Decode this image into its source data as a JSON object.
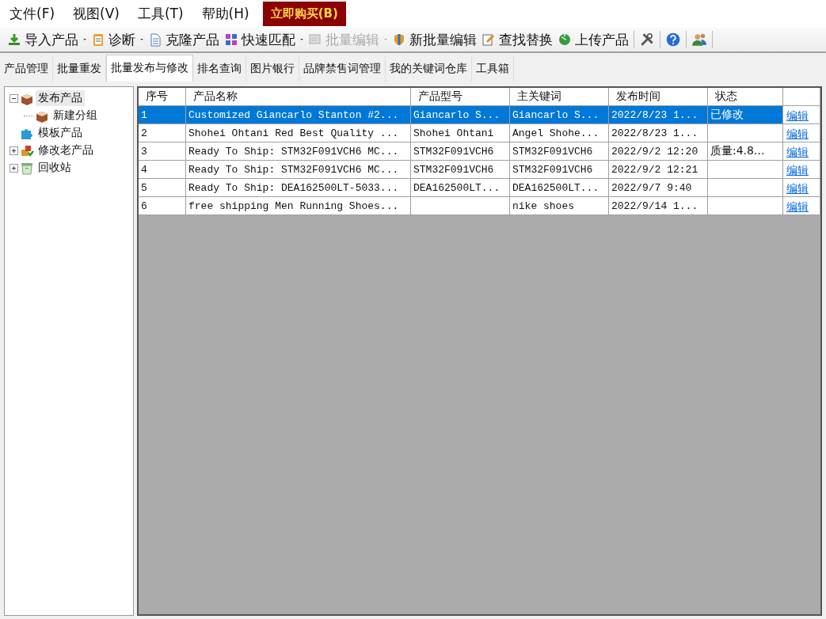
{
  "menu": [
    {
      "label": "文件(F)"
    },
    {
      "label": "视图(V)"
    },
    {
      "label": "工具(T)"
    },
    {
      "label": "帮助(H)"
    }
  ],
  "buy_button": {
    "label": "立即购买(B)"
  },
  "toolbar": [
    {
      "label": "导入产品",
      "dropdown": true,
      "disabled": false
    },
    {
      "label": "诊断",
      "dropdown": true,
      "disabled": false
    },
    {
      "label": "克隆产品",
      "dropdown": false,
      "disabled": false
    },
    {
      "label": "快速匹配",
      "dropdown": true,
      "disabled": false
    },
    {
      "label": "批量编辑",
      "dropdown": true,
      "disabled": true
    },
    {
      "label": "新批量编辑",
      "dropdown": false,
      "disabled": false
    },
    {
      "label": "查找替换",
      "dropdown": false,
      "disabled": false
    },
    {
      "label": "上传产品",
      "dropdown": false,
      "disabled": false
    }
  ],
  "tabs": [
    {
      "label": "产品管理",
      "selected": false
    },
    {
      "label": "批量重发",
      "selected": false
    },
    {
      "label": "批量发布与修改",
      "selected": true
    },
    {
      "label": "排名查询",
      "selected": false
    },
    {
      "label": "图片银行",
      "selected": false
    },
    {
      "label": "品牌禁售词管理",
      "selected": false
    },
    {
      "label": "我的关键词仓库",
      "selected": false
    },
    {
      "label": "工具箱",
      "selected": false
    }
  ],
  "tree": [
    {
      "label": "发布产品",
      "selected": true,
      "expanded": true,
      "children": [
        {
          "label": "新建分组",
          "selected": false
        }
      ]
    },
    {
      "label": "模板产品",
      "selected": false
    },
    {
      "label": "修改老产品",
      "selected": false,
      "expanded": false
    },
    {
      "label": "回收站",
      "selected": false,
      "expanded": false
    }
  ],
  "table": {
    "columns": [
      "序号",
      "产品名称",
      "产品型号",
      "主关键词",
      "发布时间",
      "状态"
    ],
    "rows": [
      {
        "no": "1",
        "name": "Customized Giancarlo Stanton #2...",
        "model": "Giancarlo S...",
        "keyword": "Giancarlo S...",
        "time": "2022/8/23 1...",
        "status": "已修改",
        "action": "编辑",
        "selected": true
      },
      {
        "no": "2",
        "name": "Shohei Ohtani Red Best Quality ...",
        "model": "Shohei Ohtani",
        "keyword": "Angel Shohe...",
        "time": "2022/8/23 1...",
        "action": "编辑",
        "selected": false
      },
      {
        "no": "3",
        "name": "Ready To Ship: STM32F091VCH6 MC...",
        "model": "STM32F091VCH6",
        "keyword": "STM32F091VCH6",
        "time": "2022/9/2 12:20",
        "status": "质量:4.8...",
        "action": "编辑",
        "selected": false
      },
      {
        "no": "4",
        "name": "Ready To Ship: STM32F091VCH6 MC...",
        "model": "STM32F091VCH6",
        "keyword": "STM32F091VCH6",
        "time": "2022/9/2 12:21",
        "action": "编辑",
        "selected": false
      },
      {
        "no": "5",
        "name": "Ready To Ship: DEA162500LT-5033...",
        "model": "DEA162500LT...",
        "keyword": "DEA162500LT...",
        "time": "2022/9/7 9:40",
        "action": "编辑",
        "selected": false
      },
      {
        "no": "6",
        "name": "free shipping Men Running Shoes...",
        "keyword": "nike shoes",
        "time": "2022/9/14 1...",
        "action": "编辑",
        "selected": false
      }
    ]
  }
}
